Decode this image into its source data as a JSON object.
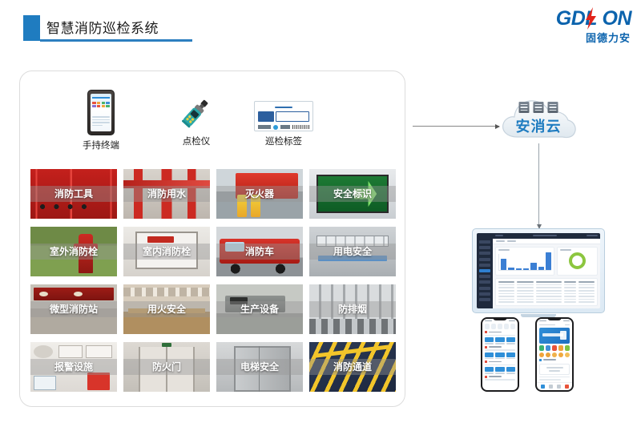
{
  "header": {
    "title": "智慧消防巡检系统",
    "accent_color": "#1f7cc0",
    "logo": {
      "main": "GDL ON",
      "main_left": "GDL",
      "main_right": "ON",
      "sub": "固德力安",
      "bolt_color": "#e2231a",
      "color": "#0b63ad"
    }
  },
  "devices": [
    {
      "name": "手持终端",
      "icon": "handheld-terminal-icon"
    },
    {
      "name": "点检仪",
      "icon": "inspection-pen-icon"
    },
    {
      "name": "巡检标签",
      "icon": "patrol-tag-icon"
    }
  ],
  "grid": {
    "columns": 4,
    "items": [
      {
        "label": "消防工具"
      },
      {
        "label": "消防用水"
      },
      {
        "label": "灭火器"
      },
      {
        "label": "安全标识"
      },
      {
        "label": "室外消防栓"
      },
      {
        "label": "室内消防栓"
      },
      {
        "label": "消防车"
      },
      {
        "label": "用电安全"
      },
      {
        "label": "微型消防站"
      },
      {
        "label": "用火安全"
      },
      {
        "label": "生产设备"
      },
      {
        "label": "防排烟"
      },
      {
        "label": "报警设施"
      },
      {
        "label": "防火门"
      },
      {
        "label": "电梯安全"
      },
      {
        "label": "消防通道"
      }
    ]
  },
  "cloud": {
    "label": "安消云",
    "color": "#1f7cc0",
    "racks": 3
  },
  "connectors": {
    "to_cloud": "arrow-right",
    "to_monitor": "arrow-down"
  },
  "monitor": {
    "chart_bars": [
      14,
      3,
      2,
      2,
      9,
      4,
      22
    ],
    "donut_color": "#8cc63f",
    "table_columns": 5,
    "table_rows": 7,
    "sidebar_items": 11,
    "active_sidebar_index": 5
  },
  "phones": [
    {
      "name": "inspection-list-app"
    },
    {
      "name": "home-dashboard-app"
    }
  ]
}
